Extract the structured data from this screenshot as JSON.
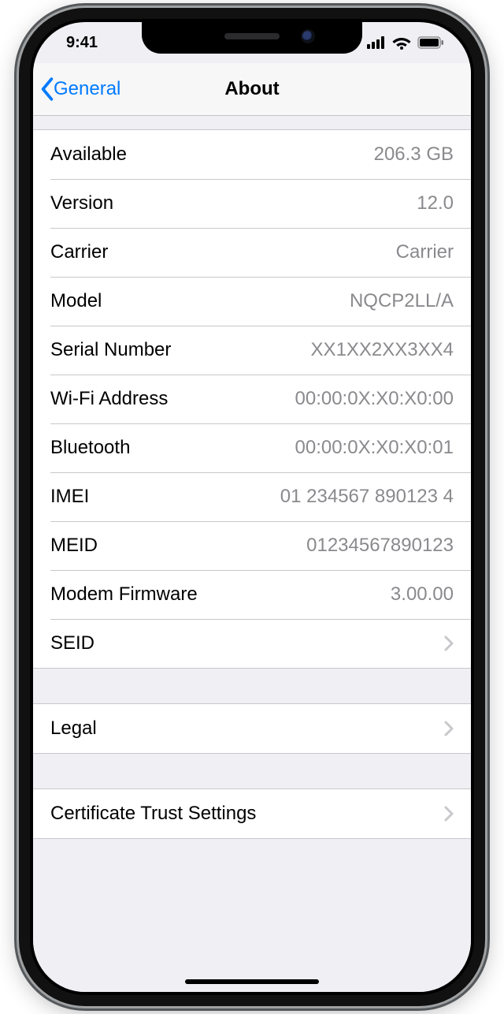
{
  "status": {
    "time": "9:41"
  },
  "nav": {
    "back_label": "General",
    "title": "About"
  },
  "about": {
    "rows": [
      {
        "label": "Available",
        "value": "206.3 GB"
      },
      {
        "label": "Version",
        "value": "12.0"
      },
      {
        "label": "Carrier",
        "value": "Carrier"
      },
      {
        "label": "Model",
        "value": "NQCP2LL/A"
      },
      {
        "label": "Serial Number",
        "value": "XX1XX2XX3XX4"
      },
      {
        "label": "Wi-Fi Address",
        "value": "00:00:0X:X0:X0:00"
      },
      {
        "label": "Bluetooth",
        "value": "00:00:0X:X0:X0:01"
      },
      {
        "label": "IMEI",
        "value": "01 234567 890123 4"
      },
      {
        "label": "MEID",
        "value": "01234567890123"
      },
      {
        "label": "Modem Firmware",
        "value": "3.00.00"
      }
    ],
    "seid_label": "SEID",
    "legal_label": "Legal",
    "cert_label": "Certificate Trust Settings"
  }
}
